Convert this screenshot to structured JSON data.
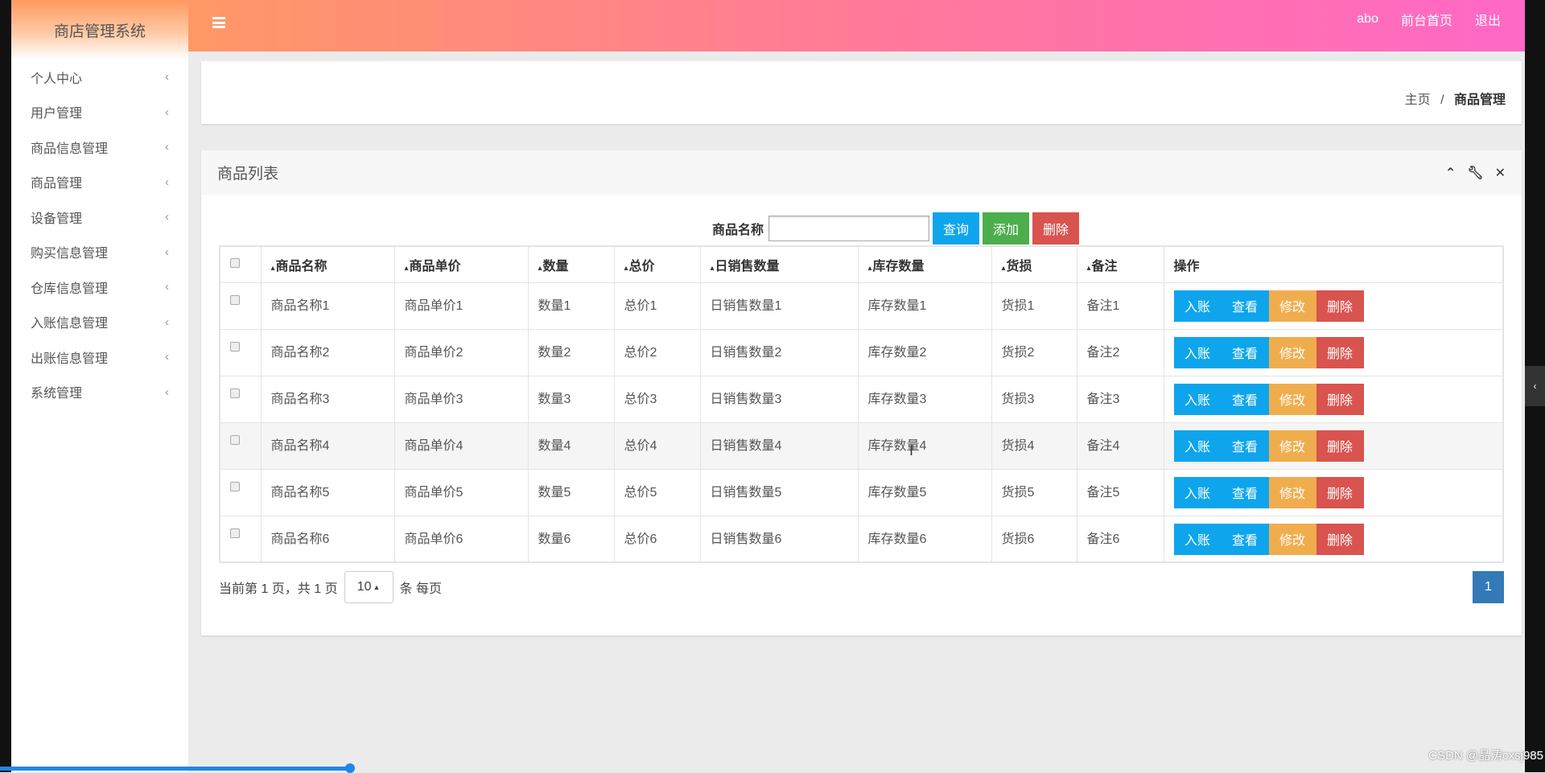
{
  "sidebar": {
    "brand": "商店管理系统",
    "items": [
      {
        "label": "个人中心"
      },
      {
        "label": "用户管理"
      },
      {
        "label": "商品信息管理"
      },
      {
        "label": "商品管理"
      },
      {
        "label": "设备管理"
      },
      {
        "label": "购买信息管理"
      },
      {
        "label": "仓库信息管理"
      },
      {
        "label": "入账信息管理"
      },
      {
        "label": "出账信息管理"
      },
      {
        "label": "系统管理"
      }
    ]
  },
  "topbar": {
    "user": "abo",
    "home": "前台首页",
    "logout": "退出"
  },
  "breadcrumb": {
    "home": "主页",
    "sep": "/",
    "current": "商品管理"
  },
  "panel": {
    "title": "商品列表"
  },
  "search": {
    "label": "商品名称",
    "value": "",
    "query": "查询",
    "add": "添加",
    "delete": "删除"
  },
  "table": {
    "headers": [
      "商品名称",
      "商品单价",
      "数量",
      "总价",
      "日销售数量",
      "库存数量",
      "货损",
      "备注"
    ],
    "action_header": "操作",
    "actions": {
      "entry": "入账",
      "view": "查看",
      "edit": "修改",
      "delete": "删除"
    },
    "rows": [
      [
        "商品名称1",
        "商品单价1",
        "数量1",
        "总价1",
        "日销售数量1",
        "库存数量1",
        "货损1",
        "备注1"
      ],
      [
        "商品名称2",
        "商品单价2",
        "数量2",
        "总价2",
        "日销售数量2",
        "库存数量2",
        "货损2",
        "备注2"
      ],
      [
        "商品名称3",
        "商品单价3",
        "数量3",
        "总价3",
        "日销售数量3",
        "库存数量3",
        "货损3",
        "备注3"
      ],
      [
        "商品名称4",
        "商品单价4",
        "数量4",
        "总价4",
        "日销售数量4",
        "库存数量4",
        "货损4",
        "备注4"
      ],
      [
        "商品名称5",
        "商品单价5",
        "数量5",
        "总价5",
        "日销售数量5",
        "库存数量5",
        "货损5",
        "备注5"
      ],
      [
        "商品名称6",
        "商品单价6",
        "数量6",
        "总价6",
        "日销售数量6",
        "库存数量6",
        "货损6",
        "备注6"
      ]
    ]
  },
  "pagination": {
    "info": "当前第 1 页，共 1 页",
    "page_size": "10",
    "per_page": "条 每页",
    "current_page": "1"
  },
  "watermark": "CSDN @晶涛cxsj985"
}
